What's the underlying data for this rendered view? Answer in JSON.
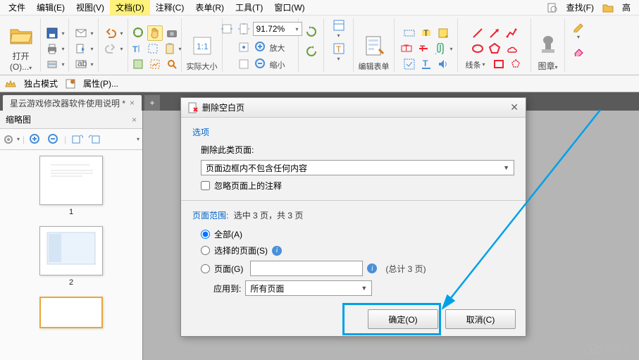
{
  "menu": {
    "file": "文件",
    "edit": "编辑(E)",
    "view": "视图(V)",
    "document": "文档(D)",
    "comment": "注释(C)",
    "form": "表单(R)",
    "tools": "工具(T)",
    "window": "窗口(W)",
    "find": "查找(F)",
    "high": "高"
  },
  "toolbar": {
    "open": "打开(O)...",
    "zoom_value": "91.72%",
    "actual_size": "实际大小",
    "zoom_in": "放大",
    "zoom_out": "缩小",
    "edit_form": "编辑表单",
    "lines": "线条",
    "stamp": "图章"
  },
  "secondbar": {
    "exclusive": "独占模式",
    "properties": "属性(P)..."
  },
  "tab": {
    "title": "星云游戏修改器软件使用说明 *"
  },
  "leftpanel": {
    "title": "缩略图",
    "page1": "1",
    "page2": "2"
  },
  "dialog": {
    "title": "删除空白页",
    "options": "选项",
    "delete_these": "删除此类页面:",
    "combo_value": "页面边框内不包含任何内容",
    "ignore_annot": "忽略页面上的注释",
    "range_label": "页面范围:",
    "range_info": "选中 3 页，共 3 页",
    "all": "全部(A)",
    "selected": "选择的页面(S)",
    "pages": "页面(G)",
    "total_pages": "(总计 3 页)",
    "apply_to": "应用到:",
    "apply_combo": "所有页面",
    "ok": "确定(O)",
    "cancel": "取消(C)"
  },
  "watermark": "亿速云"
}
